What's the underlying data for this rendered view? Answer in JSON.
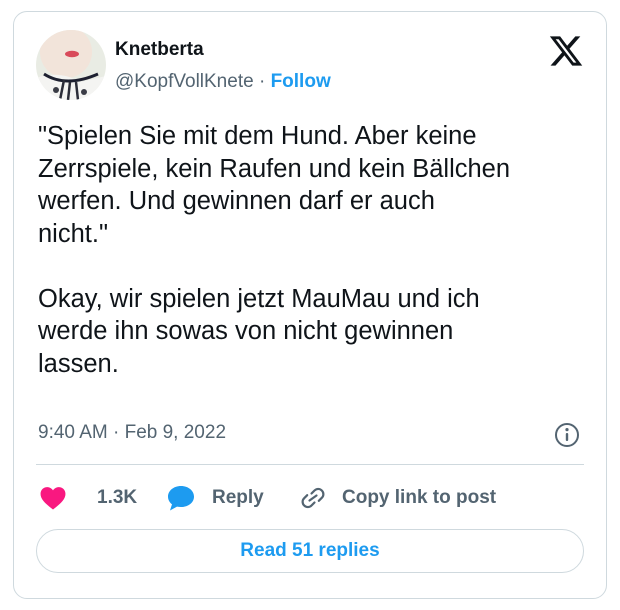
{
  "author": {
    "display_name": "Knetberta",
    "handle": "@KopfVollKnete",
    "separator": "·",
    "follow_label": "Follow",
    "avatar_icon": "profile-photo-avatar"
  },
  "platform": {
    "logo_icon": "x-logo-icon"
  },
  "tweet": {
    "text": "\"Spielen Sie mit dem Hund. Aber keine\nZerrspiele, kein Raufen und kein Bällchen\nwerfen. Und gewinnen darf er auch\nnicht.\"\n\nOkay, wir spielen jetzt MauMau und ich\nwerde ihn sowas von nicht gewinnen\nlassen.",
    "timestamp": "9:40 AM · Feb 9, 2022",
    "info_icon": "info-icon"
  },
  "actions": {
    "like_count": "1.3K",
    "like_icon": "heart-icon",
    "like_color": "#f91880",
    "reply_label": "Reply",
    "reply_icon": "speech-bubble-icon",
    "reply_icon_color": "#1d9bf0",
    "copy_label": "Copy link to post",
    "copy_icon": "link-icon"
  },
  "footer": {
    "read_replies_label": "Read 51 replies"
  },
  "colors": {
    "accent": "#1d9bf0",
    "text_primary": "#0f1419",
    "text_secondary": "#536471",
    "border": "#cfd9de"
  }
}
